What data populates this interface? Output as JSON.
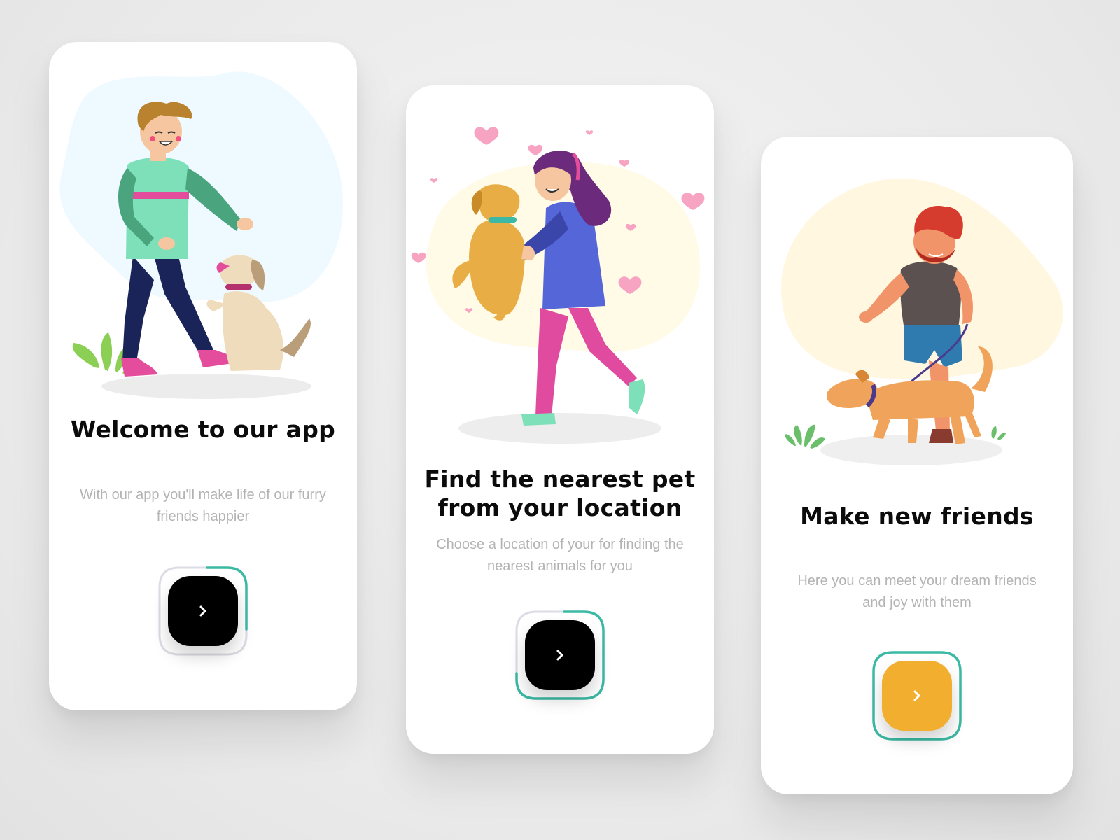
{
  "screens": [
    {
      "title": "Welcome to our app",
      "subtitle": "With our app you'll make life of our furry friends happier",
      "button_color": "#000000",
      "illustration": "man-playing-with-dog",
      "blob_color": "#eefaff"
    },
    {
      "title": "Find the nearest pet from your location",
      "subtitle": "Choose a location of your for finding the nearest animals for you",
      "button_color": "#000000",
      "illustration": "woman-hugging-dog",
      "blob_color": "#fffbe7"
    },
    {
      "title": "Make new friends",
      "subtitle": "Here you can meet your dream friends and joy with them",
      "button_color": "#f2ae2e",
      "illustration": "man-walking-dog",
      "blob_color": "#fff7df"
    }
  ],
  "colors": {
    "accent_ring": "#3cb9a4",
    "ring_muted": "#dcdce4",
    "title": "#0b0b0b",
    "subtitle": "#b3b3b3"
  },
  "icons": {
    "next": "chevron-right-icon"
  }
}
